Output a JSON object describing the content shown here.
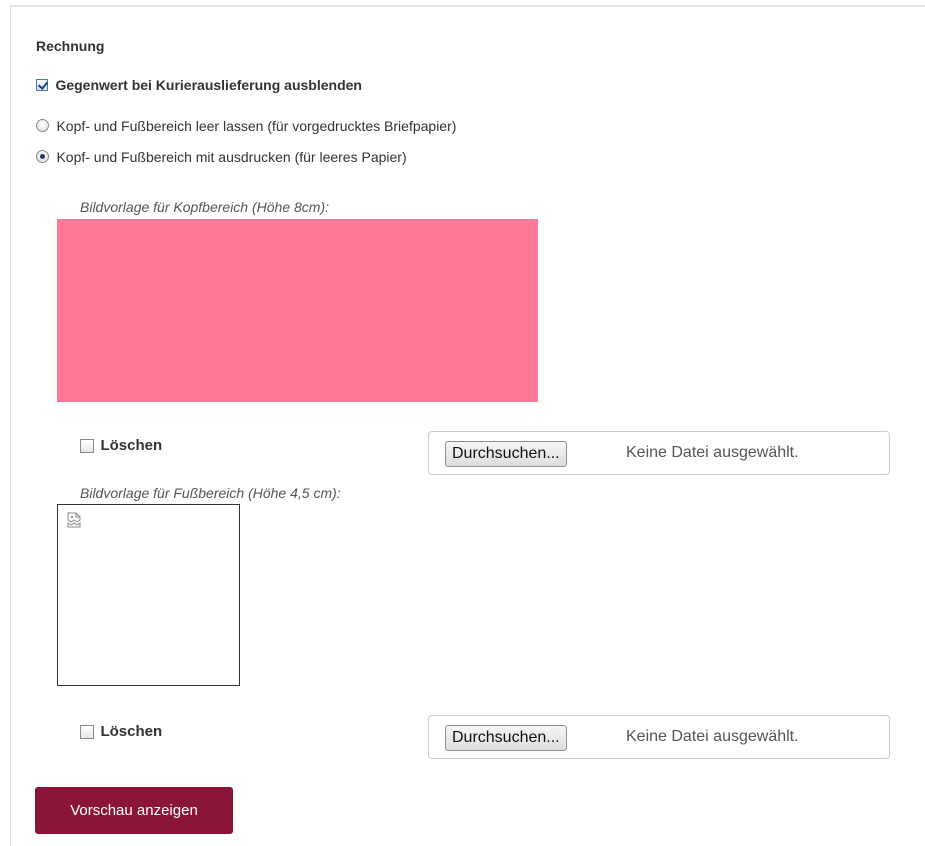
{
  "section": {
    "title": "Rechnung"
  },
  "options": {
    "hide_courier_value": {
      "label": "Gegenwert bei Kurierauslieferung ausblenden",
      "checked": true
    },
    "radio_blank": {
      "label": "Kopf- und Fußbereich leer lassen (für vorgedrucktes Briefpapier)",
      "checked": false
    },
    "radio_print": {
      "label": "Kopf- und Fußbereich mit ausdrucken (für leeres Papier)",
      "checked": true
    }
  },
  "header_image": {
    "label": "Bildvorlage für Kopfbereich (Höhe 8cm):",
    "color": "#ff7896",
    "delete_label": "Löschen",
    "browse_label": "Durchsuchen...",
    "file_status": "Keine Datei ausgewählt."
  },
  "footer_image": {
    "label": "Bildvorlage für Fußbereich (Höhe 4,5 cm):",
    "icon": "broken-image-icon",
    "delete_label": "Löschen",
    "browse_label": "Durchsuchen...",
    "file_status": "Keine Datei ausgewählt."
  },
  "actions": {
    "preview_label": "Vorschau anzeigen",
    "preview_color": "#8b1538"
  }
}
